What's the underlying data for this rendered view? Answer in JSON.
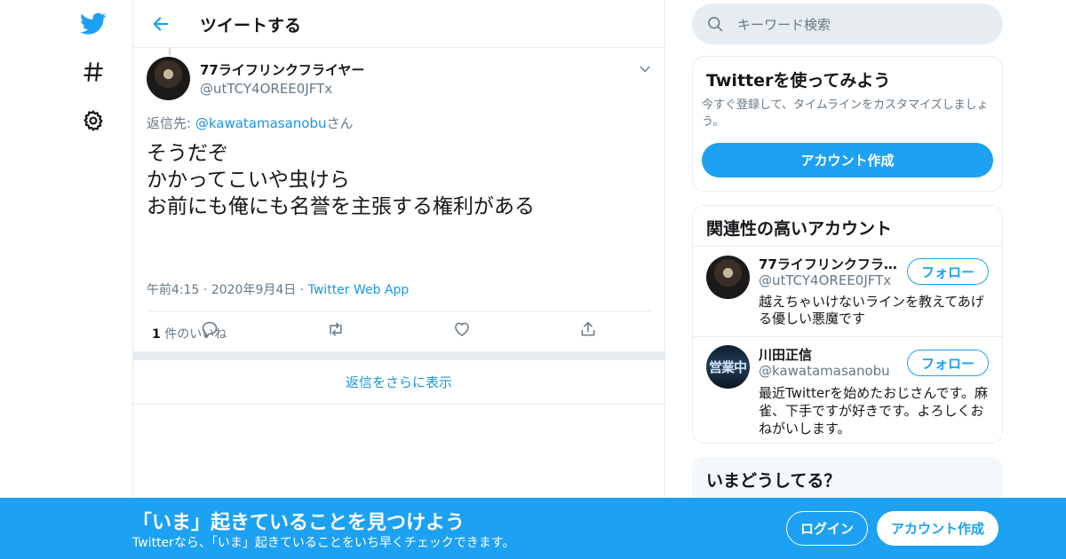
{
  "nav": {
    "icons": [
      "twitter-bird",
      "hashtag",
      "settings-gear"
    ]
  },
  "header": {
    "title": "ツイートする"
  },
  "tweet": {
    "display_name": "77ライフリンクフライヤー",
    "handle": "@utTCY4OREE0JFTx",
    "reply_prefix": "返信先: ",
    "reply_to": "@kawatamasanobu",
    "reply_suffix": "さん",
    "text_lines": [
      "そうだぞ",
      "かかってこいや虫けら",
      "お前にも俺にも名誉を主張する権利がある"
    ],
    "time": "午前4:15",
    "date": "2020年9月4日",
    "source": "Twitter Web App",
    "likes_count": "1",
    "likes_label": "件のいいね",
    "actions": [
      "reply",
      "retweet",
      "like",
      "share"
    ]
  },
  "more_replies": {
    "label": "返信をさらに表示"
  },
  "search": {
    "placeholder": "キーワード検索"
  },
  "signup_card": {
    "title": "Twitterを使ってみよう",
    "description": "今すぐ登録して、タイムラインをカスタマイズしましょう。",
    "button": "アカウント作成"
  },
  "related": {
    "title": "関連性の高いアカウント",
    "accounts": [
      {
        "name": "77ライフリンクフラ…",
        "handle": "@utTCY4OREE0JFTx",
        "bio": "越えちゃいけないラインを教えてあげる優しい悪魔です",
        "follow": "フォロー"
      },
      {
        "name": "川田正信",
        "handle": "@kawatamasanobu",
        "bio": "最近Twitterを始めたおじさんです。麻雀、下手ですが好きです。よろしくおねがいします。",
        "follow": "フォロー",
        "avatar_text": "営業中"
      }
    ]
  },
  "trends": {
    "title": "いまどうしてる？"
  },
  "bottom_bar": {
    "title": "「いま」起きていることを見つけよう",
    "subtitle": "Twitterなら、「いま」起きていることをいち早くチェックできます。",
    "login": "ログイン",
    "signup": "アカウント作成"
  },
  "colors": {
    "brand": "#1da1f2",
    "link": "#1b95e0",
    "secondary_text": "#657786",
    "border": "#e6ecf0"
  }
}
